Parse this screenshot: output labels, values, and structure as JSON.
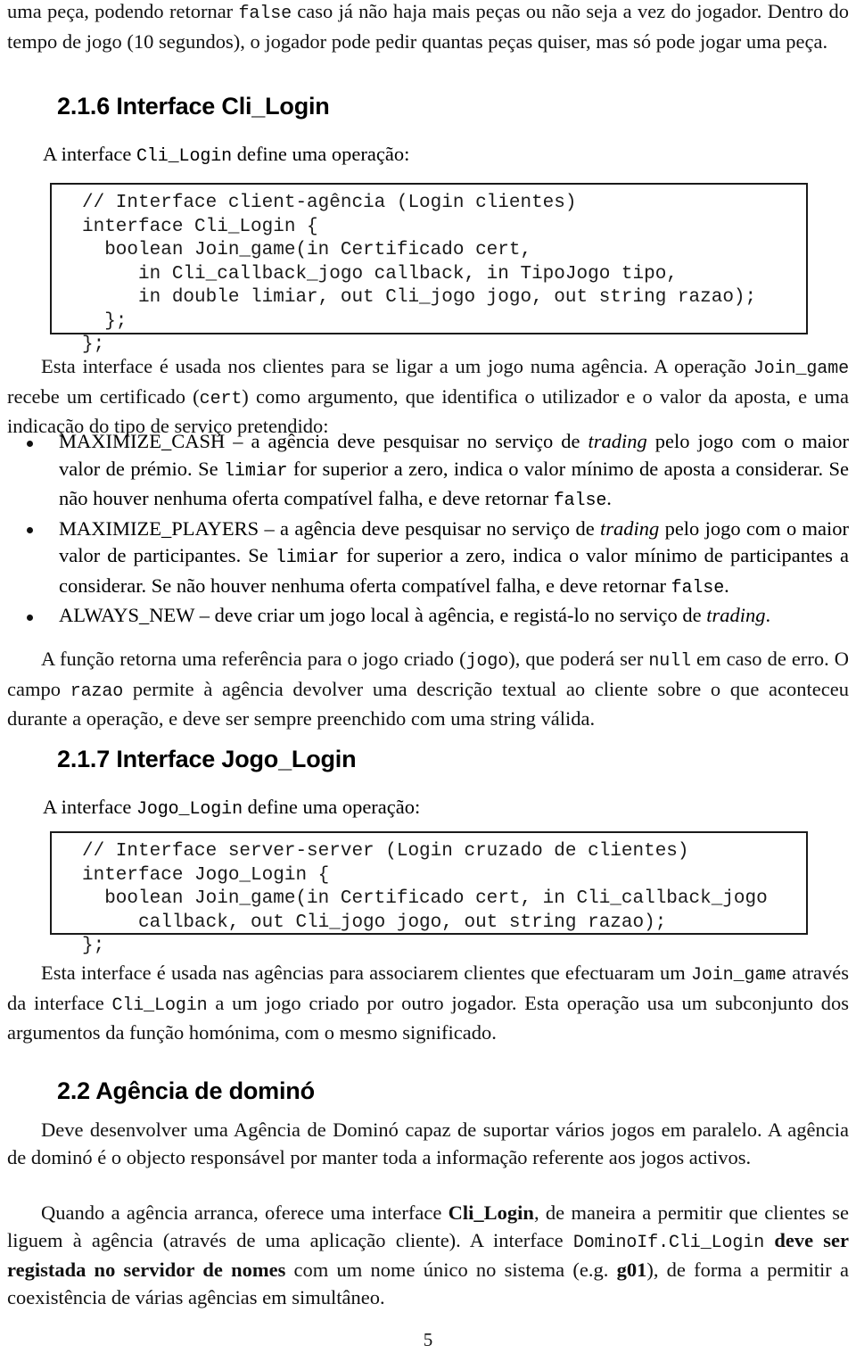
{
  "document": {
    "page_number": "5",
    "intro_paragraph": "uma peça, podendo retornar false caso já não haja mais peças ou não seja a vez do jogador. Dentro do tempo de jogo (10 segundos), o jogador pode pedir quantas peças quiser, mas só pode jogar uma peça.",
    "intro_parts": {
      "p1": "uma peça, podendo retornar ",
      "code1": "false",
      "p2": " caso já não haja mais peças ou não seja a vez do jogador. Dentro do tempo de jogo (10 segundos), o jogador pode pedir quantas peças quiser, mas só pode jogar uma peça."
    }
  },
  "sections": {
    "cli_login": {
      "heading": "2.1.6 Interface Cli_Login",
      "lead_parts": {
        "p1": "A interface ",
        "code": "Cli_Login",
        "p2": " define uma operação:"
      },
      "code_block": "// Interface client-agência (Login clientes)\ninterface Cli_Login {\n  boolean Join_game(in Certificado cert,\n     in Cli_callback_jogo callback, in TipoJogo tipo,\n     in double limiar, out Cli_jogo jogo, out string razao);\n  };\n};",
      "description_parts": {
        "p1": "Esta interface é usada nos clientes para se ligar a um jogo numa agência. A operação ",
        "code1": "Join_game",
        "p2": " recebe um certificado (",
        "code2": "cert",
        "p3": ") como argumento, que identifica o utilizador e o valor da aposta, e uma indicação do tipo de serviço pretendido:"
      },
      "bullets": [
        {
          "name": "MAXIMIZE_CASH",
          "p1": "MAXIMIZE_CASH – a agência deve pesquisar no serviço de ",
          "it1": "trading",
          "p2": " pelo jogo com o maior valor de prémio. Se ",
          "code1": "limiar",
          "p3": " for superior a zero, indica o valor mínimo de aposta a considerar. Se não houver nenhuma oferta compatível falha, e deve retornar ",
          "code2": "false",
          "p4": "."
        },
        {
          "name": "MAXIMIZE_PLAYERS",
          "p1": "MAXIMIZE_PLAYERS – a agência deve pesquisar no serviço de ",
          "it1": "trading",
          "p2": " pelo jogo com o maior valor de participantes. Se ",
          "code1": "limiar",
          "p3": " for superior a zero, indica o valor mínimo de participantes a considerar. Se não houver nenhuma oferta compatível falha, e deve retornar ",
          "code2": "false",
          "p4": "."
        },
        {
          "name": "ALWAYS_NEW",
          "p1": "ALWAYS_NEW – deve criar um jogo local à agência, e registá-lo no serviço de ",
          "it1": "trading",
          "p2": ".",
          "code1": "",
          "p3": "",
          "code2": "",
          "p4": ""
        }
      ],
      "closing_parts": {
        "p1": "A função retorna uma referência para o jogo criado (",
        "code1": "jogo",
        "p2": "), que poderá ser ",
        "code2": "null",
        "p3": " em caso de erro. O campo ",
        "code3": "razao",
        "p4": " permite à agência devolver uma descrição textual ao cliente sobre o que aconteceu durante a operação, e deve ser sempre preenchido com uma string válida."
      }
    },
    "jogo_login": {
      "heading": "2.1.7 Interface Jogo_Login",
      "lead_parts": {
        "p1": "A interface ",
        "code": "Jogo_Login",
        "p2": " define uma operação:"
      },
      "code_block": "// Interface server-server (Login cruzado de clientes)\ninterface Jogo_Login {\n  boolean Join_game(in Certificado cert, in Cli_callback_jogo\n     callback, out Cli_jogo jogo, out string razao);\n};",
      "description_parts": {
        "p1": "Esta interface é usada nas agências para associarem clientes que efectuaram um ",
        "code1": "Join_game",
        "p2": " através da interface ",
        "code2": "Cli_Login",
        "p3": " a um jogo criado por outro jogador. Esta operação usa um subconjunto dos argumentos da função homónima, com o mesmo significado."
      }
    },
    "agencia": {
      "heading": "2.2 Agência de dominó",
      "paragraph_1": "Deve desenvolver uma Agência de Dominó capaz de suportar vários jogos em paralelo. A agência de dominó é o objecto responsável por manter toda a informação referente aos jogos activos.",
      "paragraph_2_parts": {
        "p1": "Quando a agência arranca, oferece uma interface ",
        "bold1": "Cli_Login",
        "p2": ", de maneira a permitir que clientes se liguem à agência (através de uma aplicação cliente). A interface ",
        "code1": "DominoIf.Cli_Login",
        "p3": " ",
        "bold2": "deve ser registada no servidor de nomes",
        "p4": " com um nome único no sistema (e.g. ",
        "bold3": "g01",
        "p5": "), de forma a permitir a coexistência de várias agências em simultâneo."
      }
    }
  }
}
